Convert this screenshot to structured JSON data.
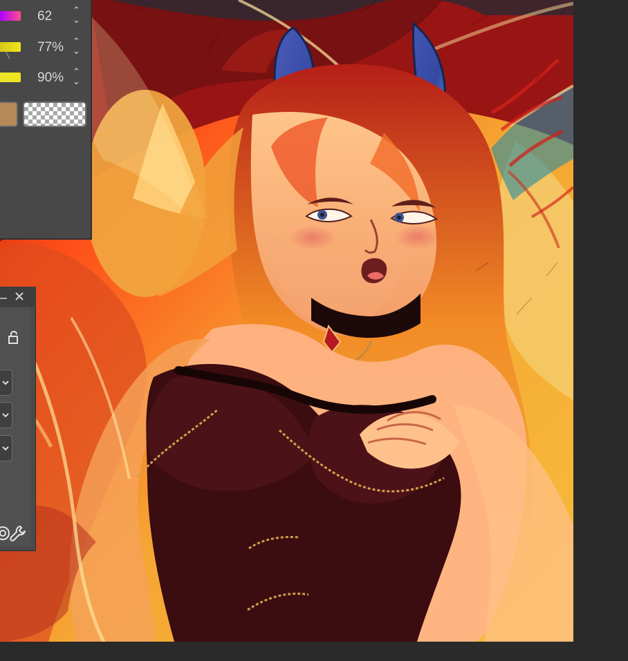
{
  "color_panel": {
    "sliders": [
      {
        "value": "62",
        "swatch_color": "#ff4f8a",
        "swatch_color_left": "#b000ff",
        "stepper": "up-down-stepper-icon"
      },
      {
        "value": "77%",
        "swatch_color": "#efe71c",
        "swatch_color_left": "#d7c81a",
        "stepper": "up-down-stepper-icon"
      },
      {
        "value": "90%",
        "swatch_color": "#f0e41d",
        "swatch_color_left": "#ece526",
        "stepper": "up-down-stepper-icon"
      }
    ],
    "main_color": "#b88958",
    "transparent_chip": "transparent-checkerboard"
  },
  "floating_panel": {
    "minimize_icon": "minimize-icon",
    "close_icon": "close-icon",
    "lock_icon": "lock-icon",
    "dropdown_icon": "chevron-down-icon",
    "tool_icon_left": "partial-tool-icon",
    "tool_icon_right": "wrench-icon"
  }
}
